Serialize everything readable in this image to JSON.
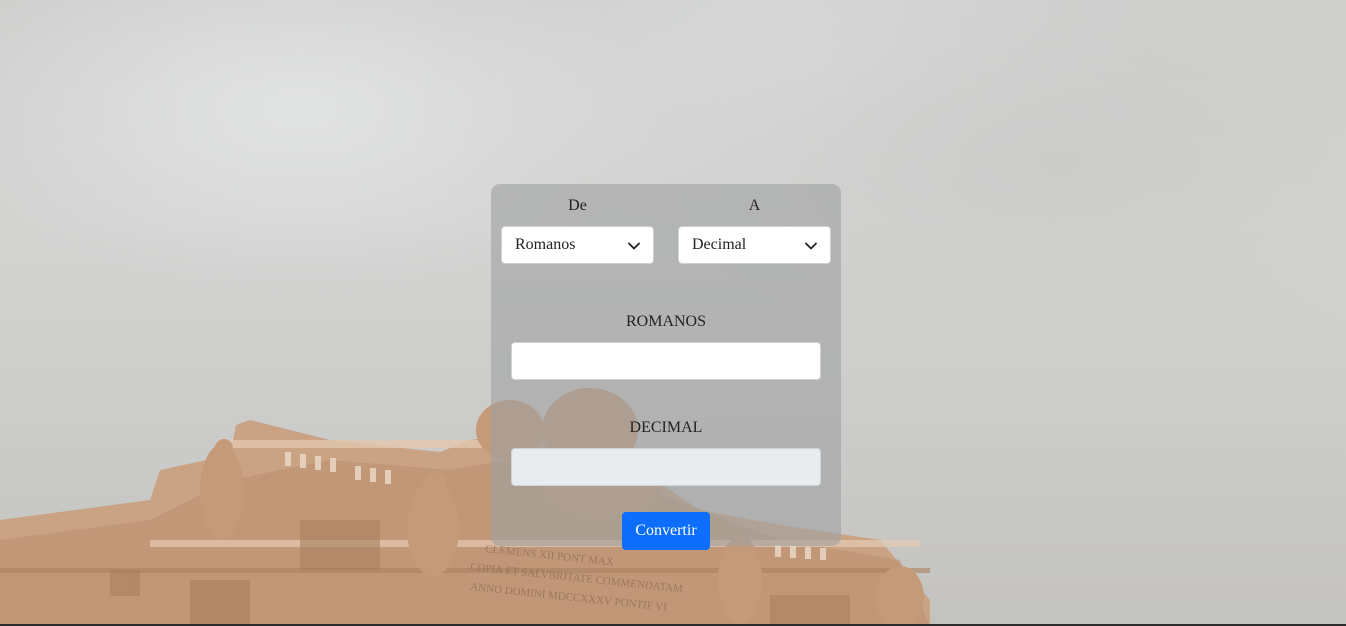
{
  "converter": {
    "from_label": "De",
    "to_label": "A",
    "from_select": {
      "selected": "Romanos",
      "icon": "chevron-down-icon"
    },
    "to_select": {
      "selected": "Decimal",
      "icon": "chevron-down-icon"
    },
    "input_label": "ROMANOS",
    "input_value": "",
    "output_label": "DECIMAL",
    "output_value": "",
    "convert_button": "Convertir"
  },
  "colors": {
    "button": "#0d6efd",
    "panel": "#a0a1a2",
    "disabled_field": "#e9ecef"
  }
}
